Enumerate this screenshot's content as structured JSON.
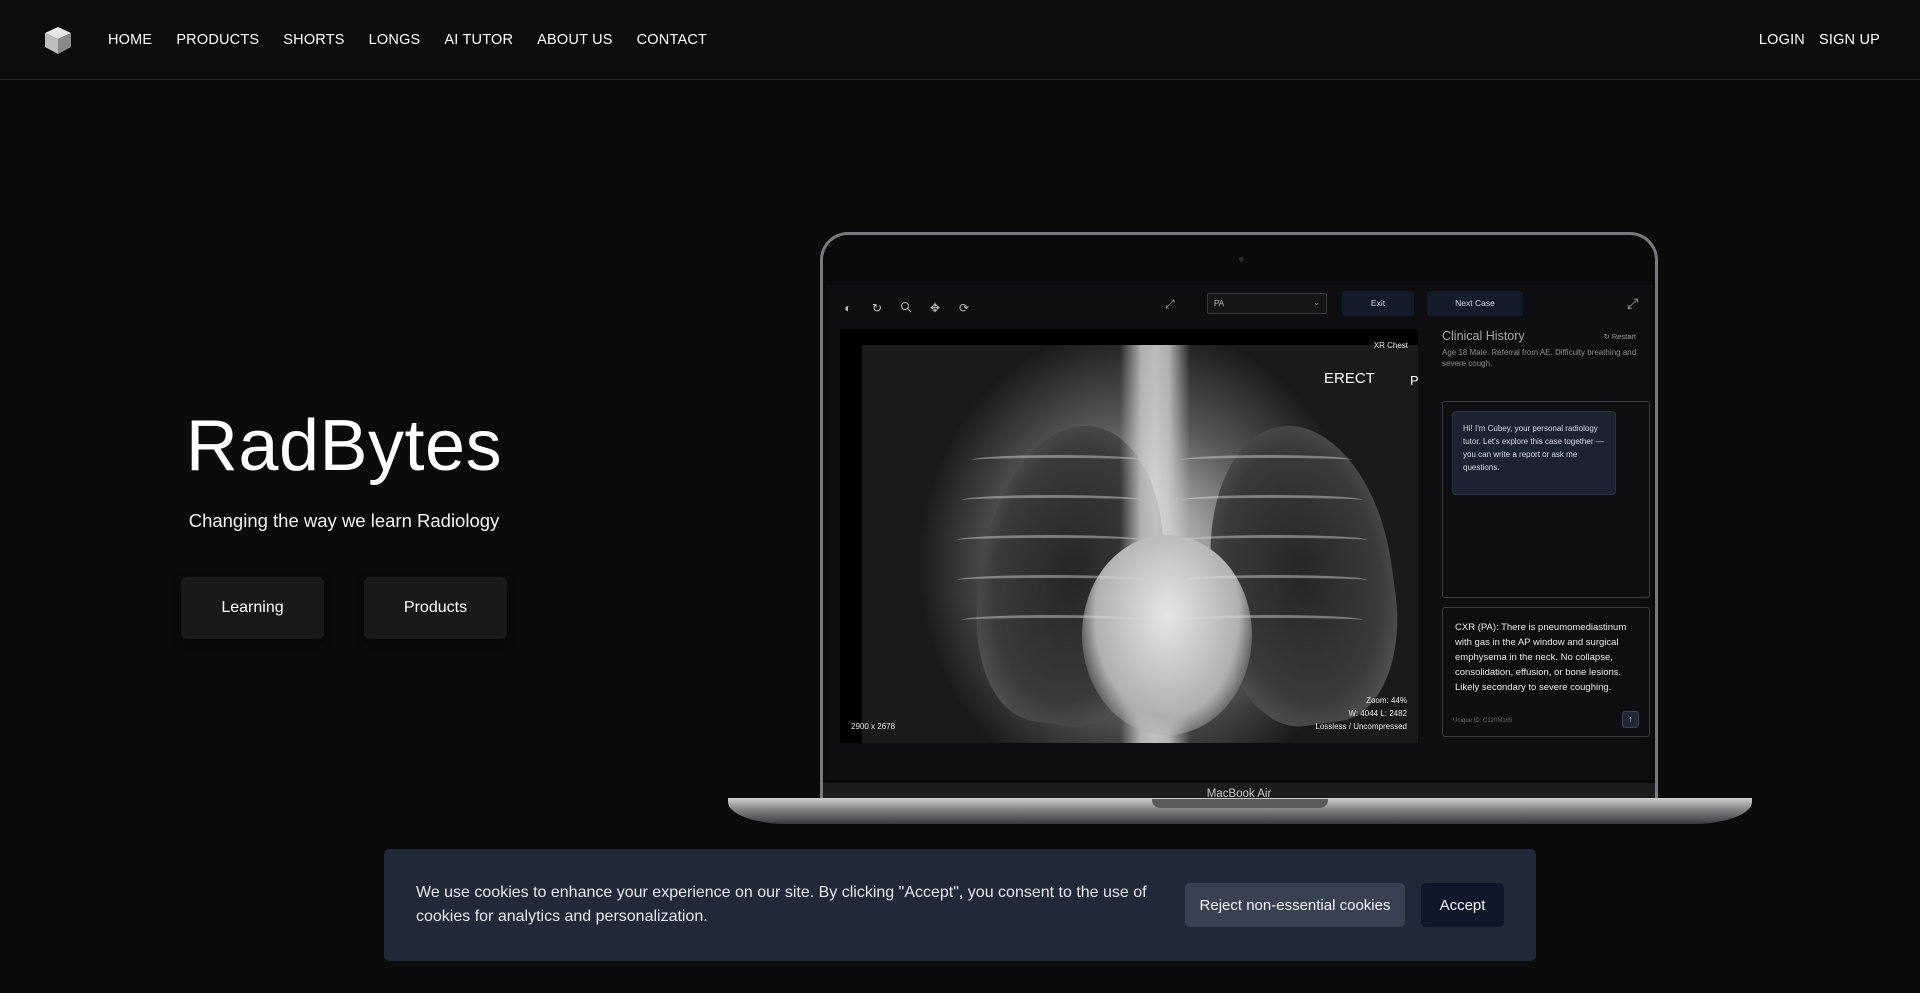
{
  "nav": {
    "logo_icon": "cube-icon",
    "links": [
      "HOME",
      "PRODUCTS",
      "SHORTS",
      "LONGS",
      "AI TUTOR",
      "ABOUT US",
      "CONTACT"
    ],
    "login": "LOGIN",
    "signup": "SIGN UP"
  },
  "hero": {
    "title": "RadBytes",
    "subtitle": "Changing the way we learn Radiology",
    "learning_button": "Learning",
    "products_button": "Products"
  },
  "laptop": {
    "label": "MacBook Air",
    "viewer": {
      "tools": [
        "contrast-icon",
        "rotate-icon",
        "zoom-icon",
        "pan-icon",
        "reset-icon"
      ],
      "view_select": "PA",
      "exit_button": "Exit",
      "next_button": "Next Case",
      "image_label": "XR Chest",
      "marker": "ERECT",
      "side_marker": "P",
      "dimensions": "2900 x 2678",
      "zoom": "Zoom: 44%",
      "window_level": "W: 4044 L: 2482",
      "compression": "Lossless / Uncompressed"
    },
    "panel": {
      "clinical_title": "Clinical History",
      "restart": "Restart",
      "clinical_text": "Age 18 Male. Referral from AE. Difficulty breathing and severe cough.",
      "chat_message": "Hi! I'm Cubey, your personal radiology tutor. Let's explore this case together — you can write a report or ask me questions.",
      "report_text": "CXR (PA): There is pneumomediastinum with gas in the AP window and surgical emphysema in the neck. No collapse, consolidation, effusion, or bone lesions. Likely secondary to severe coughing.",
      "unique_id": "Unique ID: C120M165"
    }
  },
  "cookie": {
    "text": "We use cookies to enhance your experience on our site. By clicking \"Accept\", you consent to the use of cookies for analytics and personalization.",
    "reject": "Reject non-essential cookies",
    "accept": "Accept"
  }
}
